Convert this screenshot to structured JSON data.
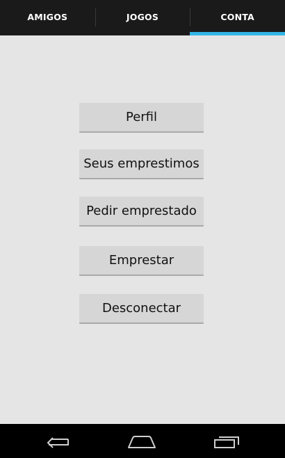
{
  "tabs": [
    {
      "label": "AMIGOS",
      "selected": false
    },
    {
      "label": "JOGOS",
      "selected": false
    },
    {
      "label": "CONTA",
      "selected": true
    }
  ],
  "menu": {
    "perfil": "Perfil",
    "seus_emprestimos": "Seus emprestimos",
    "pedir_emprestado": "Pedir emprestado",
    "emprestar": "Emprestar",
    "desconectar": "Desconectar"
  },
  "navbar": {
    "icons": [
      "back-icon",
      "home-icon",
      "recent-apps-icon"
    ]
  },
  "colors": {
    "tab_indicator": "#33b5e5",
    "tab_bar": "#1a1a1a",
    "background": "#e5e5e5",
    "button": "#d6d6d6"
  }
}
